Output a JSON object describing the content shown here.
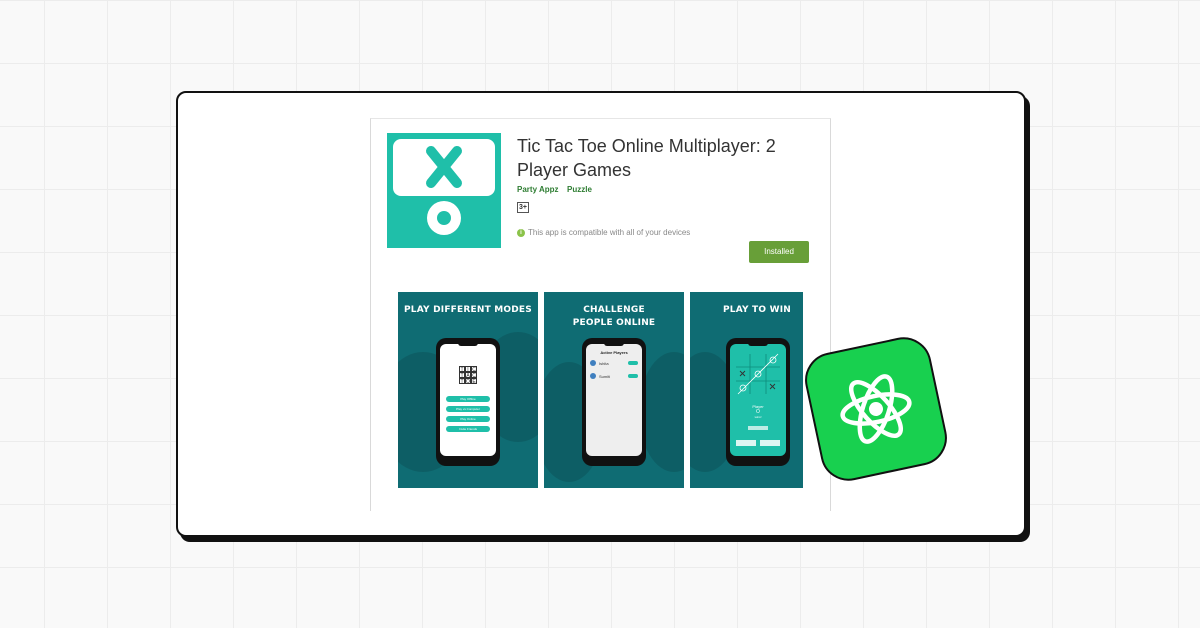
{
  "app": {
    "title": "Tic Tac Toe Online Multiplayer: 2 Player Games",
    "developer": "Party Appz",
    "category": "Puzzle",
    "content_rating": "3+",
    "compatibility": "This app is compatible with all of your devices",
    "install_button": "Installed"
  },
  "screenshots": [
    {
      "heading": "PLAY DIFFERENT MODES",
      "board": [
        "T",
        "I",
        "C",
        "T",
        "A",
        "C",
        "T",
        "O",
        "E"
      ],
      "menu": [
        "Play Offline",
        "Play vs Computer",
        "Play Online",
        "Invite Friends"
      ]
    },
    {
      "heading": "CHALLENGE  PEOPLE ONLINE",
      "screen_title": "Active Players",
      "players": [
        "Ishita",
        "Sumiti"
      ]
    },
    {
      "heading": "PLAY TO WIN",
      "status": "Player",
      "turn": "O",
      "status_sub": "wins!"
    }
  ],
  "colors": {
    "brand_teal": "#1fbfa9",
    "screenshot_bg": "#0f6c73",
    "install_green": "#689f38",
    "react_green": "#18d04f"
  },
  "icons": [
    "app-icon-x",
    "app-icon-o",
    "info-icon",
    "react-atom-icon"
  ]
}
